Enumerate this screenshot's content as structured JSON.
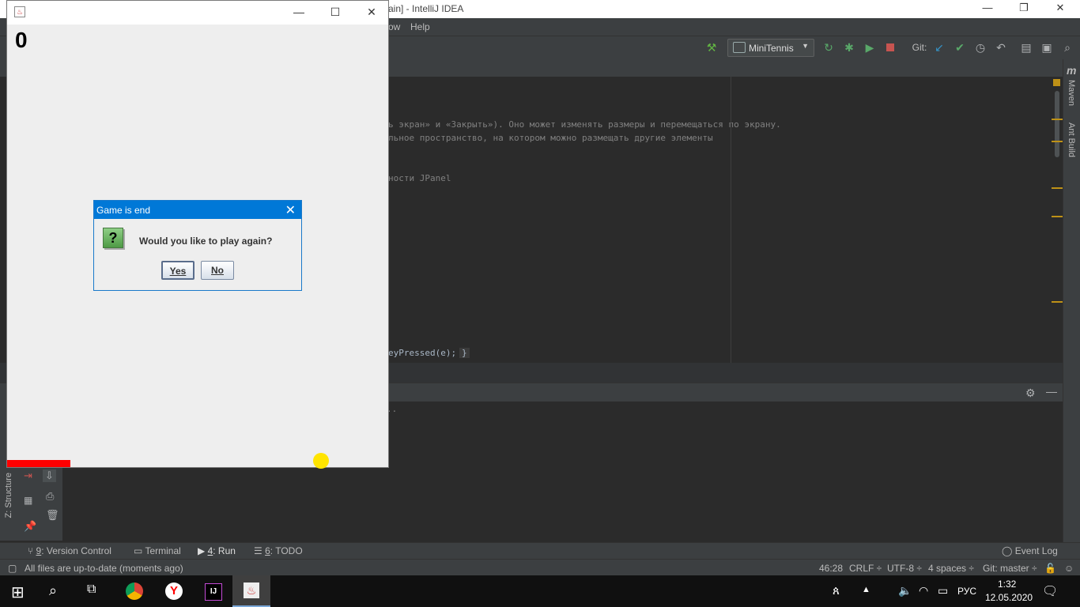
{
  "ide": {
    "title": "ain] - IntelliJ IDEA",
    "menu_partial": "ow",
    "menu_help": "Help",
    "run_config": "MiniTennis",
    "git_label": "Git:",
    "code_lines": [
      "ь экран» и «Закрыть»). Оно может изменять размеры и перемещаться по экрану.",
      "льное пространство, на котором можно размещать другие элементы",
      "ности JPanel",
      "eyPressed(e);"
    ],
    "code_brace": "}",
    "console_line": "..",
    "right_panel": {
      "maven": "Maven",
      "ant": "Ant Build"
    },
    "left_panel": {
      "structure": "Z: Structure"
    },
    "bottom_tabs": [
      {
        "num": "9",
        "label": ": Version Control"
      },
      {
        "label": "Terminal"
      },
      {
        "num": "4",
        "label": ": Run"
      },
      {
        "num": "6",
        "label": ": TODO"
      }
    ],
    "event_log": "Event Log",
    "status": {
      "message": "All files are up-to-date (moments ago)",
      "position": "46:28",
      "line_sep": "CRLF ÷",
      "encoding": "UTF-8 ÷",
      "indent": "4 spaces ÷",
      "branch": "Git: master ÷"
    }
  },
  "game": {
    "score": "0"
  },
  "dialog": {
    "title": "Game is end",
    "message": "Would you like to play again?",
    "yes": "Yes",
    "no": "No",
    "icon": "?"
  },
  "taskbar": {
    "apps": [
      "chrome",
      "yandex",
      "intellij",
      "java"
    ],
    "lang": "РУС",
    "time": "1:32",
    "date": "12.05.2020"
  },
  "colors": {
    "accent": "#0078d7",
    "paddle": "#ff0000",
    "ball": "#ffe400",
    "ide_bg": "#2b2b2b"
  }
}
